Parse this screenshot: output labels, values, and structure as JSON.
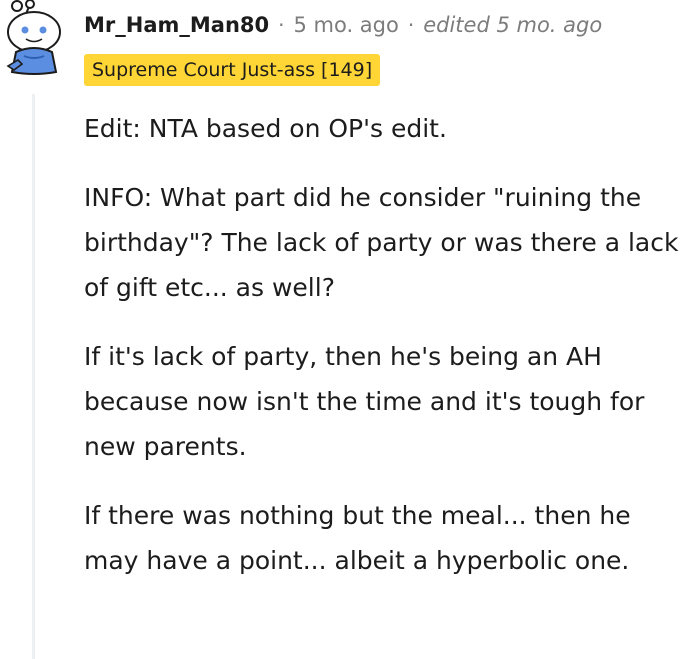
{
  "comment": {
    "username": "Mr_Ham_Man80",
    "separator": "·",
    "time_ago": "5 mo. ago",
    "edited": "edited 5 mo. ago",
    "flair": "Supreme Court Just-ass [149]",
    "paragraphs": [
      "Edit: NTA based on OP's edit.",
      "INFO: What part did he consider \"ruining the birthday\"? The lack of party or was there a lack of gift etc... as well?",
      "If it's lack of party, then he's being an AH because now isn't the time and it's tough for new parents.",
      "If there was nothing but the meal... then he may have a point... albeit a hyperbolic one."
    ]
  },
  "colors": {
    "flair_bg": "#ffd635",
    "avatar_body": "#5b8de0",
    "meta_text": "#7c7c7c",
    "thread_line": "#edeff1"
  },
  "icons": {
    "avatar": "reddit-snoo-avatar-icon"
  }
}
